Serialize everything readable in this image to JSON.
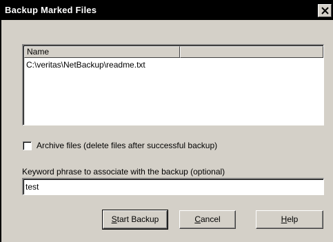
{
  "window": {
    "title": "Backup Marked Files",
    "close_glyph": "×"
  },
  "file_list": {
    "columns": [
      "Name",
      ""
    ],
    "items": [
      "C:\\veritas\\NetBackup\\readme.txt"
    ]
  },
  "archive_checkbox": {
    "label": "Archive files (delete files after successful backup)",
    "checked": false
  },
  "keyword": {
    "label": "Keyword phrase to associate with the backup (optional)",
    "value": "test"
  },
  "buttons": {
    "start_mnemonic": "S",
    "start_rest": "tart Backup",
    "cancel_mnemonic": "C",
    "cancel_rest": "ancel",
    "help_mnemonic": "H",
    "help_rest": "elp"
  },
  "icons": {
    "close": "close-icon",
    "checkbox": "checkbox-unchecked"
  }
}
